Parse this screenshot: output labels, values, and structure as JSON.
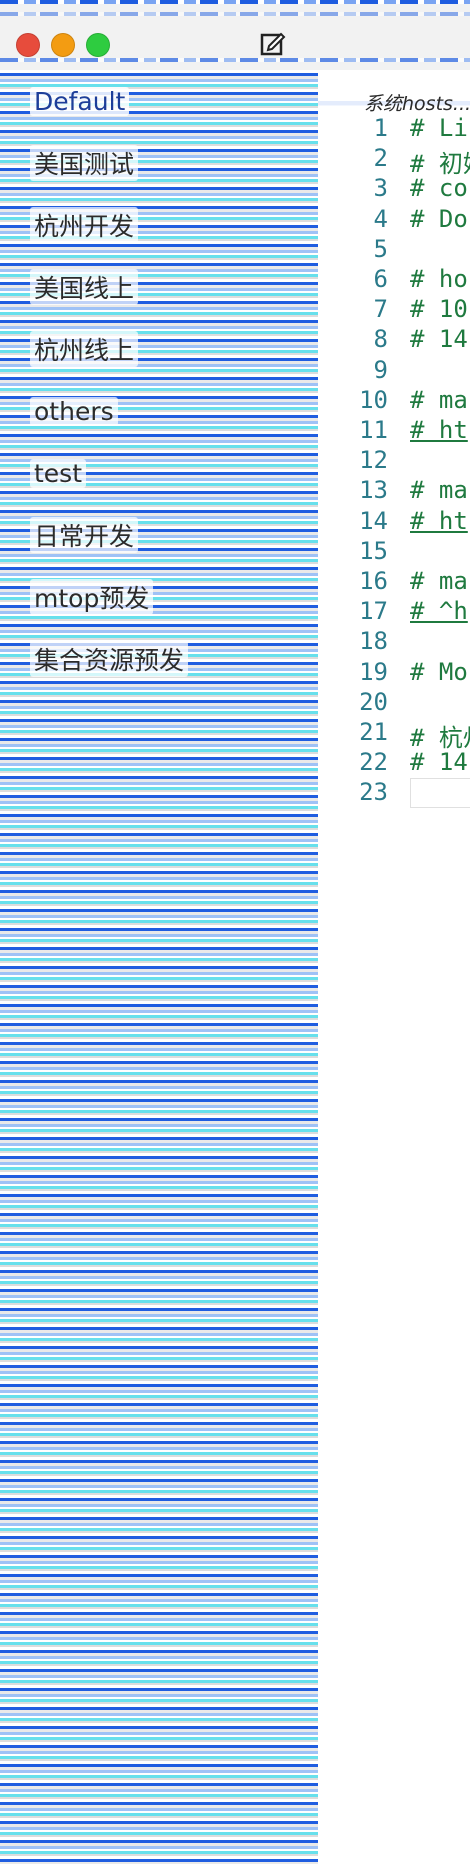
{
  "window": {
    "traffic_lights": [
      "#e74c3c",
      "#f39c12",
      "#2ecc40"
    ]
  },
  "sidebar": {
    "items": [
      {
        "label": "Default",
        "active": true
      },
      {
        "label": "美国测试"
      },
      {
        "label": "杭州开发"
      },
      {
        "label": "美国线上"
      },
      {
        "label": "杭州线上"
      },
      {
        "label": "others"
      },
      {
        "label": "test"
      },
      {
        "label": "日常开发"
      },
      {
        "label": "mtop预发"
      },
      {
        "label": "集合资源预发"
      }
    ]
  },
  "editor": {
    "tab_title": "系统hosts...",
    "lines": [
      {
        "n": "1",
        "text": "# Li"
      },
      {
        "n": "2",
        "text": "# 初始"
      },
      {
        "n": "3",
        "text": "# co"
      },
      {
        "n": "4",
        "text": "# Do"
      },
      {
        "n": "5",
        "text": ""
      },
      {
        "n": "6",
        "text": "# ho"
      },
      {
        "n": "7",
        "text": "# 10"
      },
      {
        "n": "8",
        "text": "# 14"
      },
      {
        "n": "9",
        "text": ""
      },
      {
        "n": "10",
        "text": "# ma"
      },
      {
        "n": "11",
        "text": "# ht",
        "link": true
      },
      {
        "n": "12",
        "text": ""
      },
      {
        "n": "13",
        "text": "# ma"
      },
      {
        "n": "14",
        "text": "# ht",
        "link": true
      },
      {
        "n": "15",
        "text": ""
      },
      {
        "n": "16",
        "text": "# ma"
      },
      {
        "n": "17",
        "text": "# ^h",
        "link": true
      },
      {
        "n": "18",
        "text": ""
      },
      {
        "n": "19",
        "text": "# Mo"
      },
      {
        "n": "20",
        "text": ""
      },
      {
        "n": "21",
        "text": "# 杭州"
      },
      {
        "n": "22",
        "text": "# 14"
      },
      {
        "n": "23",
        "text": ""
      }
    ]
  },
  "icons": {
    "edit": "edit-square-icon"
  }
}
